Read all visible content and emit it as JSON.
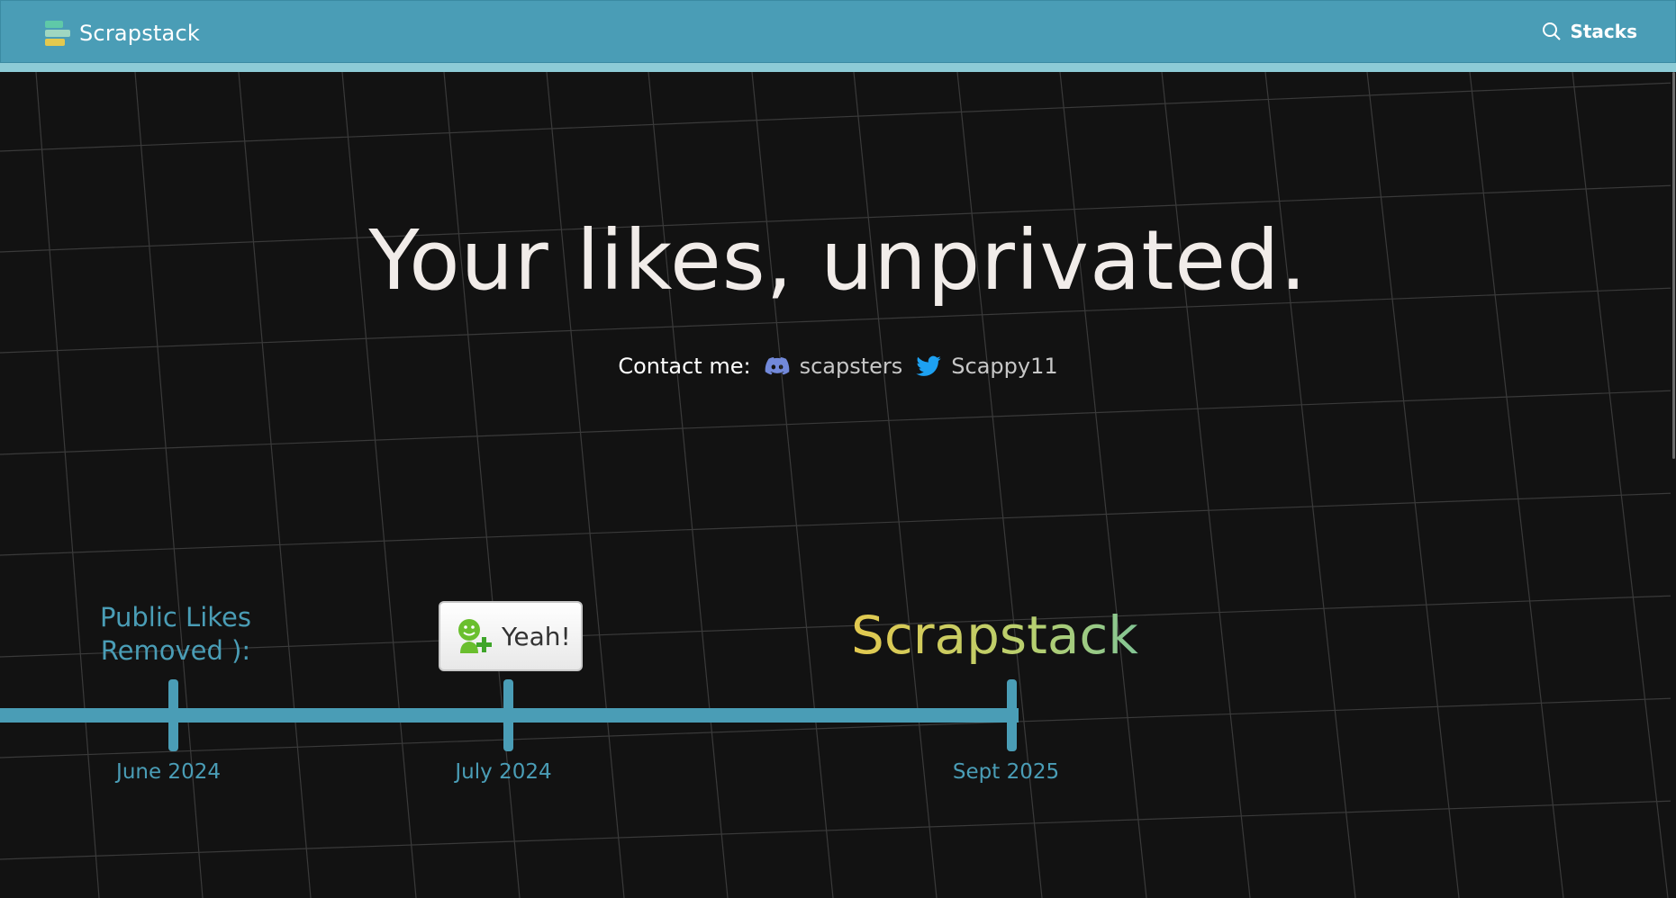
{
  "navbar": {
    "brand_name": "Scrapstack",
    "stacks_label": "Stacks",
    "color": "#4a9db6"
  },
  "hero": {
    "title": "Your likes, unprivated.",
    "contact_label": "Contact me:",
    "discord_handle": "scapsters",
    "twitter_handle": "Scappy11"
  },
  "timeline": {
    "event_1": "Public Likes Removed ):",
    "event_2_button": "Yeah!",
    "event_3": "Scrapstack",
    "dates": [
      "June 2024",
      "July 2024",
      "Sept 2025"
    ]
  },
  "icons": {
    "brand": "scrapstack-logo-icon",
    "search": "search-icon",
    "discord": "discord-icon",
    "twitter": "twitter-icon",
    "yeah": "smiley-plus-icon"
  }
}
